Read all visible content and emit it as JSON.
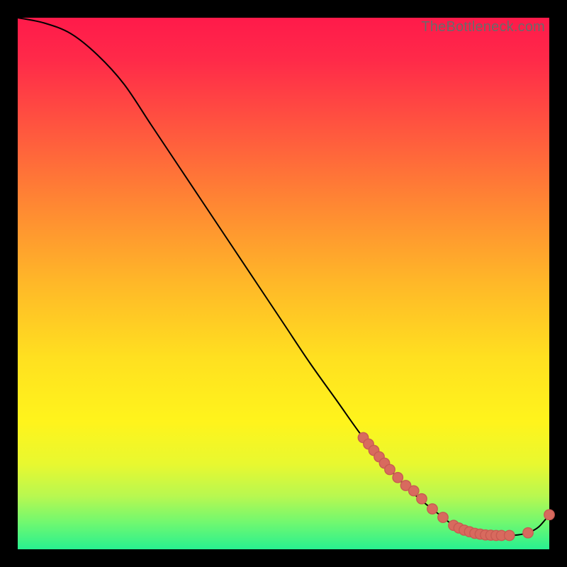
{
  "watermark": "TheBottleneck.com",
  "chart_data": {
    "type": "line",
    "title": "",
    "xlabel": "",
    "ylabel": "",
    "xlim": [
      0,
      100
    ],
    "ylim": [
      0,
      100
    ],
    "grid": false,
    "series": [
      {
        "name": "curve",
        "x": [
          0,
          5,
          10,
          15,
          20,
          25,
          30,
          35,
          40,
          45,
          50,
          55,
          60,
          65,
          70,
          75,
          80,
          82,
          84,
          86,
          88,
          90,
          92,
          94,
          96,
          98,
          100
        ],
        "values": [
          100,
          99,
          97,
          93,
          87.5,
          80,
          72.5,
          65,
          57.5,
          50,
          42.5,
          35,
          28,
          21,
          15,
          10,
          6,
          4.5,
          3.6,
          3.0,
          2.7,
          2.6,
          2.6,
          2.7,
          3.1,
          4.2,
          6.5
        ]
      }
    ],
    "scatter_points": [
      {
        "x": 65.0,
        "y": 21.0
      },
      {
        "x": 66.0,
        "y": 19.8
      },
      {
        "x": 67.0,
        "y": 18.6
      },
      {
        "x": 68.0,
        "y": 17.4
      },
      {
        "x": 69.0,
        "y": 16.2
      },
      {
        "x": 70.0,
        "y": 15.0
      },
      {
        "x": 71.5,
        "y": 13.5
      },
      {
        "x": 73.0,
        "y": 12.0
      },
      {
        "x": 74.5,
        "y": 11.0
      },
      {
        "x": 76.0,
        "y": 9.5
      },
      {
        "x": 78.0,
        "y": 7.6
      },
      {
        "x": 80.0,
        "y": 6.0
      },
      {
        "x": 82.0,
        "y": 4.5
      },
      {
        "x": 83.0,
        "y": 4.0
      },
      {
        "x": 84.0,
        "y": 3.6
      },
      {
        "x": 85.0,
        "y": 3.3
      },
      {
        "x": 86.0,
        "y": 3.0
      },
      {
        "x": 87.0,
        "y": 2.85
      },
      {
        "x": 88.0,
        "y": 2.7
      },
      {
        "x": 89.0,
        "y": 2.65
      },
      {
        "x": 90.0,
        "y": 2.6
      },
      {
        "x": 91.0,
        "y": 2.6
      },
      {
        "x": 92.5,
        "y": 2.6
      },
      {
        "x": 96.0,
        "y": 3.1
      },
      {
        "x": 100.0,
        "y": 6.5
      }
    ],
    "dot_radius": 7.2
  }
}
